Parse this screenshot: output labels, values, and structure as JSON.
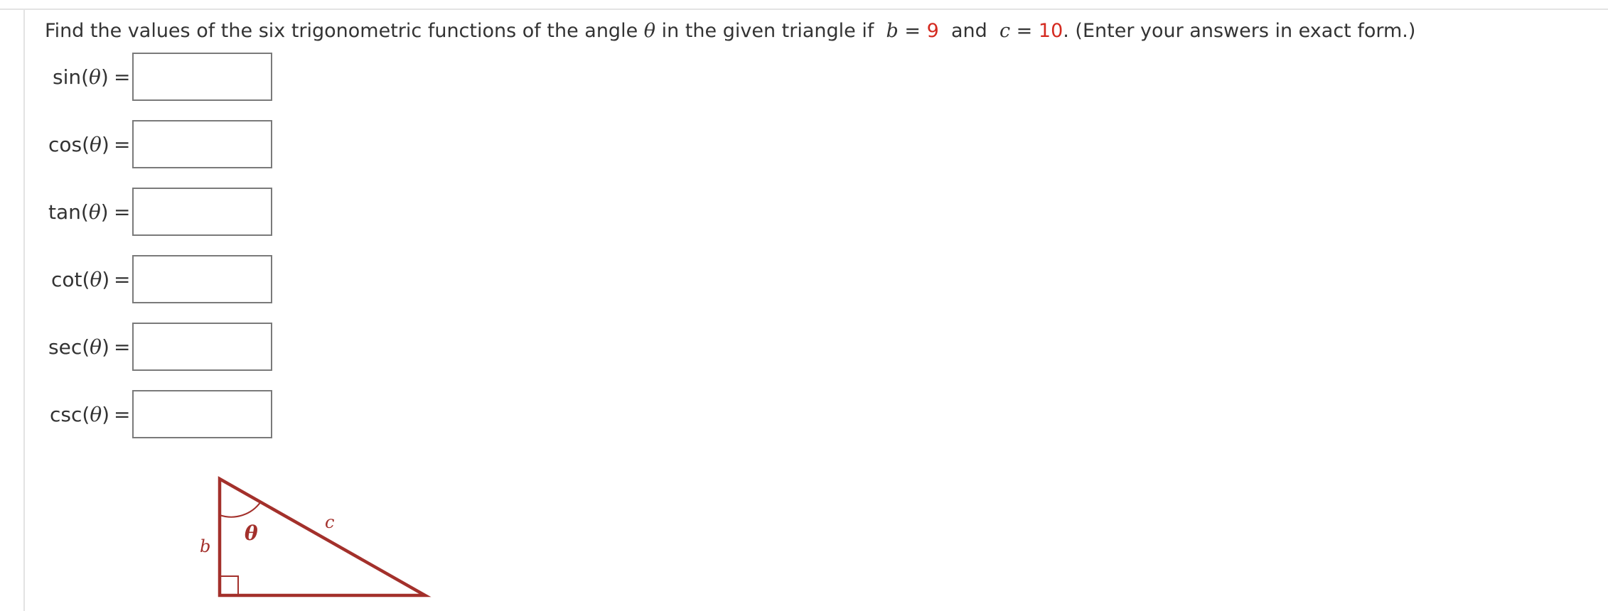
{
  "question": {
    "prefix": "Find the values of the six trigonometric functions of the angle",
    "theta": "θ",
    "middle": "in the given triangle if",
    "b_var": "b",
    "eq1": "=",
    "b_value": "9",
    "and": "and",
    "c_var": "c",
    "eq2": "=",
    "c_value": "10",
    "suffix": ". (Enter your answers in exact form.)"
  },
  "functions": [
    {
      "name": "sin",
      "label": "sin(",
      "theta": "θ",
      "close": ")",
      "equals": "=",
      "value": ""
    },
    {
      "name": "cos",
      "label": "cos(",
      "theta": "θ",
      "close": ")",
      "equals": "=",
      "value": ""
    },
    {
      "name": "tan",
      "label": "tan(",
      "theta": "θ",
      "close": ")",
      "equals": "=",
      "value": ""
    },
    {
      "name": "cot",
      "label": "cot(",
      "theta": "θ",
      "close": ")",
      "equals": "=",
      "value": ""
    },
    {
      "name": "sec",
      "label": "sec(",
      "theta": "θ",
      "close": ")",
      "equals": "=",
      "value": ""
    },
    {
      "name": "csc",
      "label": "csc(",
      "theta": "θ",
      "close": ")",
      "equals": "=",
      "value": ""
    }
  ],
  "figure": {
    "b_label": "b",
    "c_label": "c",
    "theta_label": "θ",
    "stroke_color": "#a3302b",
    "highlight_color": "#d42a20"
  }
}
